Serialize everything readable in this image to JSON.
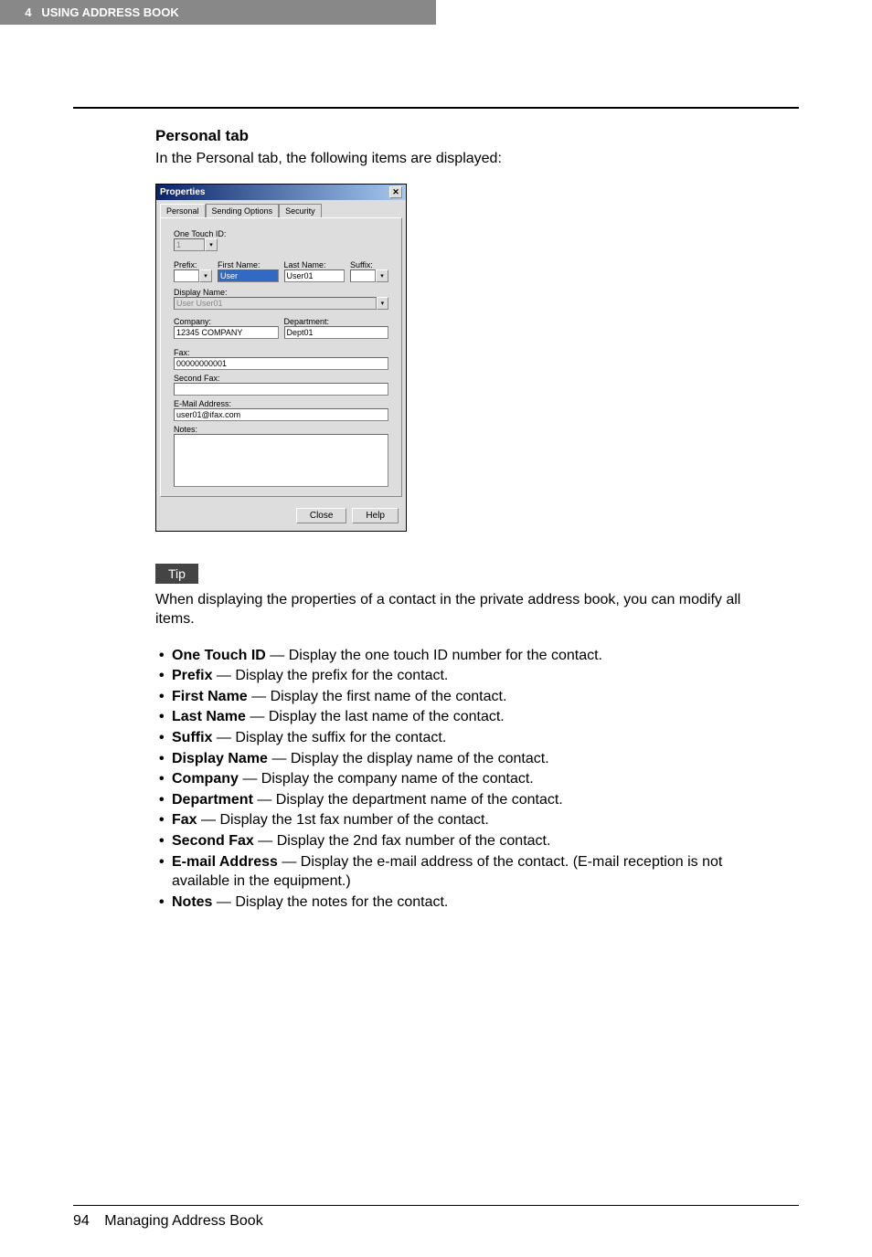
{
  "header": {
    "chapter_num": "4",
    "chapter": "USING ADDRESS BOOK"
  },
  "section": {
    "title": "Personal tab",
    "intro": "In the Personal tab, the following items are displayed:"
  },
  "dialog": {
    "title": "Properties",
    "tabs": {
      "personal": "Personal",
      "sending_options": "Sending Options",
      "security": "Security"
    },
    "fields": {
      "one_touch_id_label": "One Touch ID:",
      "one_touch_id_value": "1",
      "prefix_label": "Prefix:",
      "prefix_value": "",
      "first_name_label": "First Name:",
      "first_name_value": "User",
      "last_name_label": "Last Name:",
      "last_name_value": "User01",
      "suffix_label": "Suffix:",
      "suffix_value": "",
      "display_name_label": "Display Name:",
      "display_name_value": "User User01",
      "company_label": "Company:",
      "company_value": "12345 COMPANY",
      "department_label": "Department:",
      "department_value": "Dept01",
      "fax_label": "Fax:",
      "fax_value": "00000000001",
      "second_fax_label": "Second Fax:",
      "second_fax_value": "",
      "email_label": "E-Mail Address:",
      "email_value": "user01@ifax.com",
      "notes_label": "Notes:",
      "notes_value": ""
    },
    "buttons": {
      "close": "Close",
      "help": "Help"
    }
  },
  "tip": {
    "badge": "Tip",
    "text": "When displaying the properties of a contact in the private address book, you can modify all items."
  },
  "bullets": [
    {
      "term": "One Touch ID",
      "desc": " — Display the one touch ID number for the contact."
    },
    {
      "term": "Prefix",
      "desc": " — Display the prefix for the contact."
    },
    {
      "term": "First Name",
      "desc": " — Display the first name of the contact."
    },
    {
      "term": "Last Name",
      "desc": " — Display the last name of the contact."
    },
    {
      "term": "Suffix",
      "desc": " — Display the suffix for the contact."
    },
    {
      "term": "Display Name",
      "desc": " — Display the display name of the contact."
    },
    {
      "term": "Company",
      "desc": " — Display the company name of the contact."
    },
    {
      "term": "Department",
      "desc": " — Display the department name of the contact."
    },
    {
      "term": "Fax",
      "desc": " — Display the 1st fax number of the contact."
    },
    {
      "term": "Second Fax",
      "desc": " — Display the 2nd fax number of the contact."
    },
    {
      "term": "E-mail Address",
      "desc": " — Display the e-mail address of the contact. (E-mail reception is not available in the equipment.)"
    },
    {
      "term": "Notes",
      "desc": " — Display the notes for the contact."
    }
  ],
  "footer": {
    "page": "94",
    "title": "Managing Address Book"
  }
}
